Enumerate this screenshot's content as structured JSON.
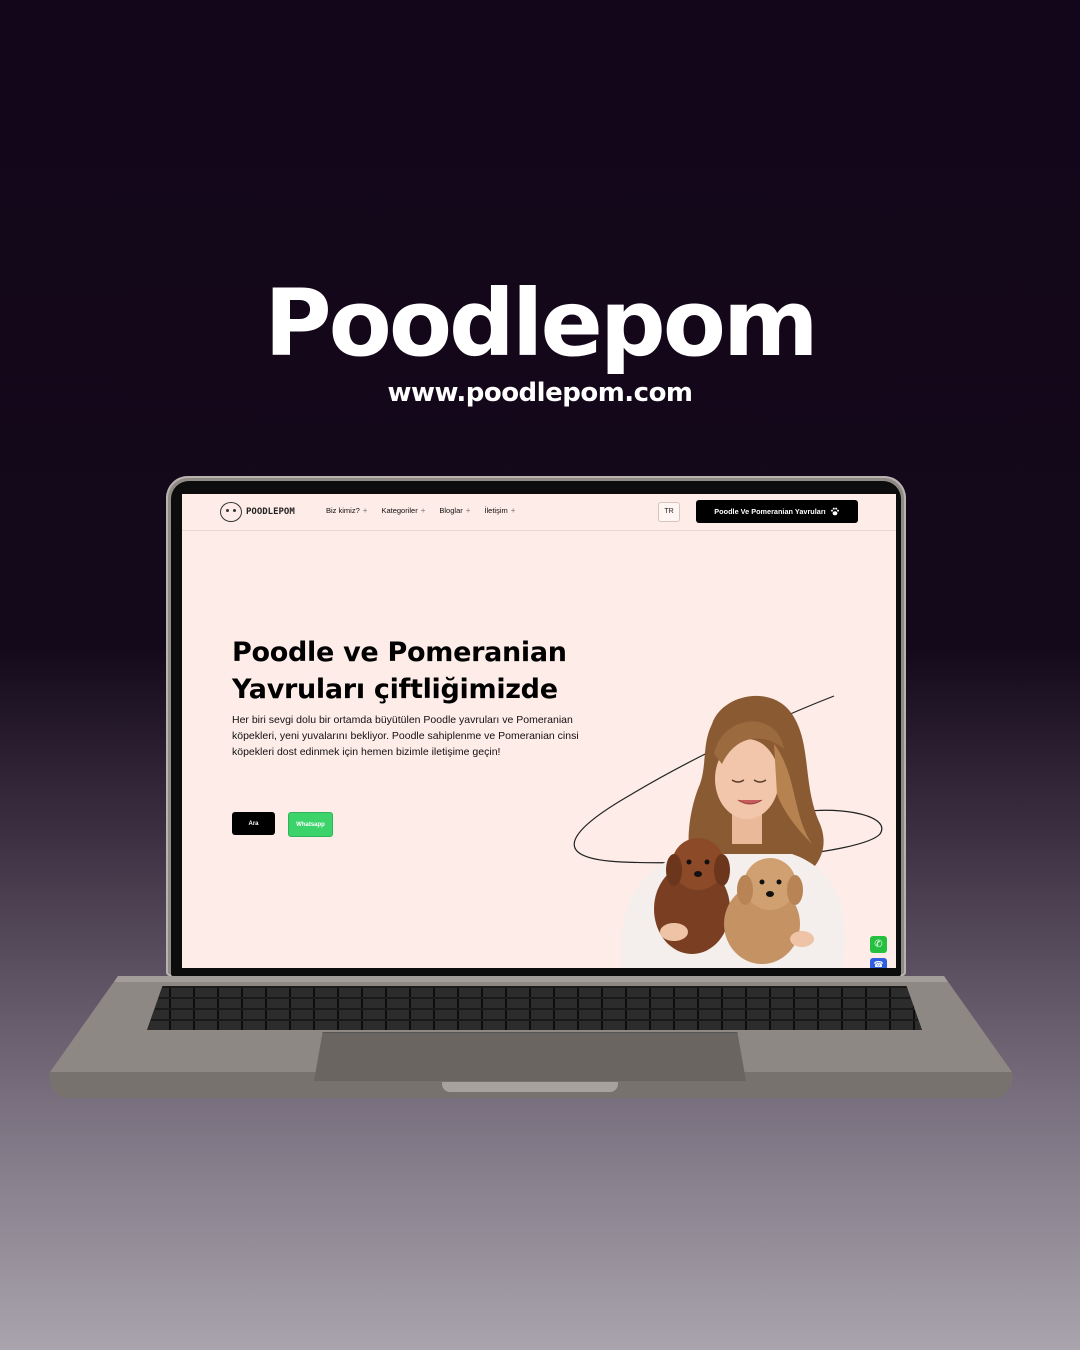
{
  "brand": {
    "title": "Poodlepom",
    "url": "www.poodlepom.com"
  },
  "site": {
    "logo_text": "POODLEPOM",
    "nav": [
      {
        "label": "Biz kimiz?"
      },
      {
        "label": "Kategoriler"
      },
      {
        "label": "Bloglar"
      },
      {
        "label": "İletişim"
      }
    ],
    "nav_plus": "+",
    "lang": "TR",
    "cta_label": "Poodle Ve Pomeranian Yavruları",
    "cta_icon": "paw-icon",
    "hero": {
      "title_line1": "Poodle ve Pomeranian",
      "title_line2": "Yavruları çiftliğimizde",
      "text": "Her biri sevgi dolu bir ortamda büyütülen Poodle yavruları ve Pomeranian köpekleri, yeni yuvalarını bekliyor. Poodle sahiplenme ve Pomeranian cinsi köpekleri dost edinmek için hemen bizimle iletişime geçin!",
      "btn_call": "Ara",
      "btn_whatsapp": "Whatsapp"
    },
    "floating": {
      "whatsapp_icon": "whatsapp-icon",
      "phone_icon": "phone-icon"
    }
  },
  "colors": {
    "page_bg_top": "#13061a",
    "screen_bg": "#fdece7",
    "cta_bg": "#000000",
    "whatsapp_green": "#3cd36b"
  }
}
